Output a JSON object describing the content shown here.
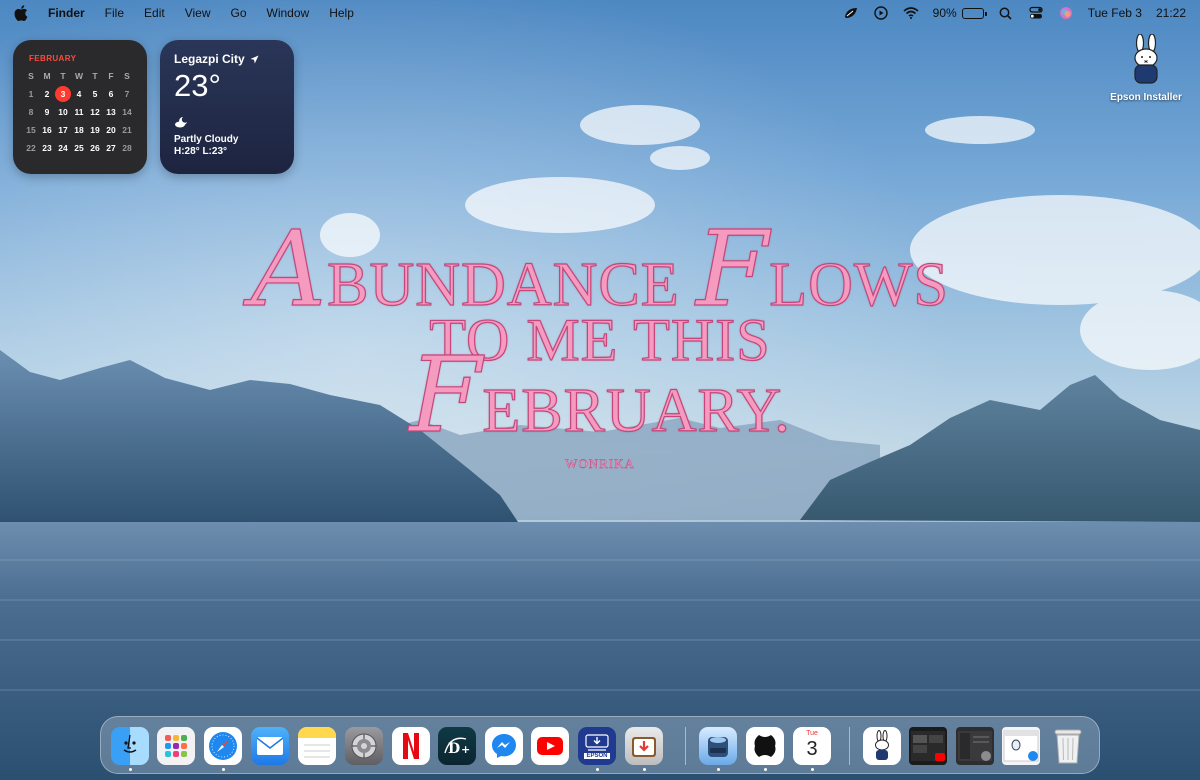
{
  "menubar": {
    "app_name": "Finder",
    "menus": [
      "File",
      "Edit",
      "View",
      "Go",
      "Window",
      "Help"
    ],
    "battery_percent": "90%",
    "battery_level": 0.9,
    "date": "Tue Feb 3",
    "time": "21:22"
  },
  "calendar_widget": {
    "month": "FEBRUARY",
    "weekdays": [
      "S",
      "M",
      "T",
      "W",
      "T",
      "F",
      "S"
    ],
    "weeks": [
      [
        "1",
        "2",
        "3",
        "4",
        "5",
        "6",
        "7"
      ],
      [
        "8",
        "9",
        "10",
        "11",
        "12",
        "13",
        "14"
      ],
      [
        "15",
        "16",
        "17",
        "18",
        "19",
        "20",
        "21"
      ],
      [
        "22",
        "23",
        "24",
        "25",
        "26",
        "27",
        "28"
      ]
    ],
    "today": "3",
    "accent_color": "#ff3b30"
  },
  "weather_widget": {
    "city": "Legazpi City",
    "temperature": "23°",
    "condition": "Partly Cloudy",
    "high_low": "H:28° L:23°",
    "condition_icon": "partly-cloudy-night-icon"
  },
  "desktop": {
    "icons": [
      {
        "label": "Epson Installer",
        "icon": "miffy-installer-icon"
      }
    ]
  },
  "wallpaper": {
    "quote_line1_cap1": "A",
    "quote_line1_word1": "BUNDANCE ",
    "quote_line1_cap2": "F",
    "quote_line1_word2": "LOWS",
    "quote_line2": "TO ME THIS",
    "quote_line3_cap": "F",
    "quote_line3_word": "EBRUARY.",
    "author": "WONRIKA",
    "text_color": "#f49bbf"
  },
  "dock": {
    "apps": [
      {
        "name": "Finder",
        "icon": "finder-icon",
        "running": true
      },
      {
        "name": "Launchpad",
        "icon": "launchpad-icon",
        "running": false
      },
      {
        "name": "Safari",
        "icon": "safari-icon",
        "running": true
      },
      {
        "name": "Mail",
        "icon": "mail-icon",
        "running": false
      },
      {
        "name": "Notes",
        "icon": "notes-icon",
        "running": false
      },
      {
        "name": "System Settings",
        "icon": "settings-icon",
        "running": false
      },
      {
        "name": "Netflix",
        "icon": "netflix-icon",
        "running": false
      },
      {
        "name": "Disney+",
        "icon": "disney-plus-icon",
        "running": false
      },
      {
        "name": "Messenger",
        "icon": "messenger-icon",
        "running": false
      },
      {
        "name": "YouTube",
        "icon": "youtube-icon",
        "running": false
      },
      {
        "name": "Epson",
        "icon": "epson-icon",
        "label": "EPSON",
        "running": true
      },
      {
        "name": "Installer",
        "icon": "installer-icon",
        "running": true
      },
      {
        "name": "Downloads Disk",
        "icon": "disk-icon",
        "running": true
      },
      {
        "name": "Black App",
        "icon": "black-shape-icon",
        "running": true
      },
      {
        "name": "Calendar",
        "icon": "calendar-icon",
        "cal_day": "Tue",
        "cal_num": "3",
        "running": true
      },
      {
        "name": "Miffy Window",
        "icon": "miffy-window-icon"
      },
      {
        "name": "YouTube Window",
        "icon": "youtube-window-icon"
      },
      {
        "name": "Settings Window",
        "icon": "settings-window-icon"
      },
      {
        "name": "Safari Window",
        "icon": "safari-window-icon"
      },
      {
        "name": "Trash",
        "icon": "trash-icon"
      }
    ]
  }
}
